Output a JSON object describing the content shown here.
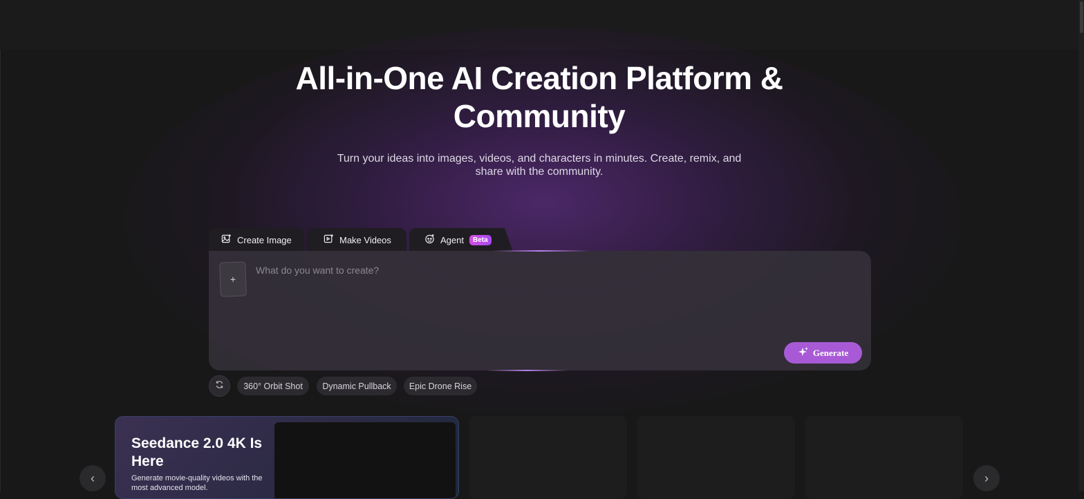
{
  "hero": {
    "title": "All-in-One AI Creation Platform & Community",
    "subtitle": "Turn your ideas into images, videos, and characters in minutes. Create, remix, and share with the community."
  },
  "tabs": [
    {
      "label": "Create Image",
      "icon": "image-icon"
    },
    {
      "label": "Make Videos",
      "icon": "video-icon"
    },
    {
      "label": "Agent",
      "icon": "agent-icon",
      "badge": "Beta"
    }
  ],
  "prompt": {
    "placeholder": "What do you want to create?",
    "upload_label": "+",
    "generate_label": "Generate"
  },
  "suggestions": [
    "360° Orbit Shot",
    "Dynamic Pullback",
    "Epic Drone Rise"
  ],
  "carousel": {
    "prev_label": "‹",
    "next_label": "›",
    "feature": {
      "title": "Seedance 2.0 4K Is Here",
      "description": "Generate movie-quality videos with the most advanced model."
    }
  },
  "colors": {
    "accent": "#a85ad6",
    "badge": "#d24fe0",
    "background": "#181818"
  }
}
